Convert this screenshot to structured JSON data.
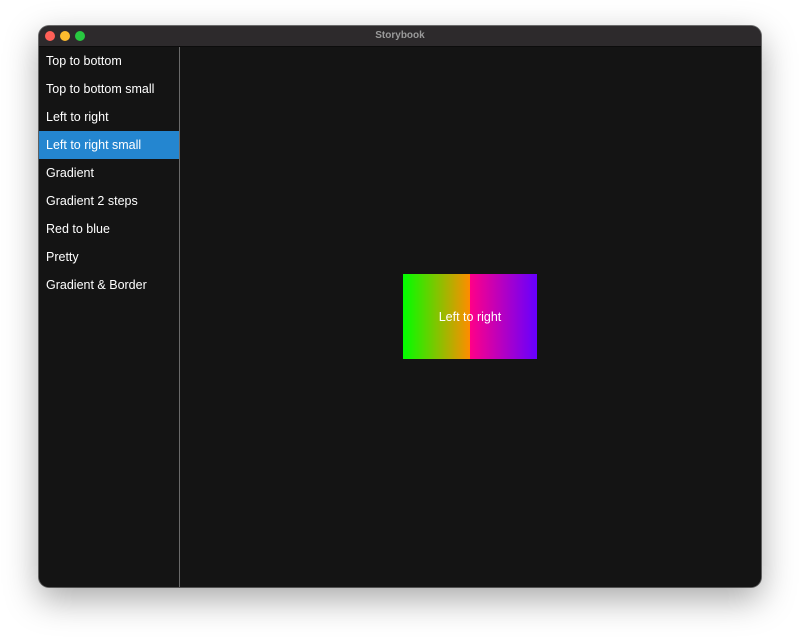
{
  "window": {
    "title": "Storybook"
  },
  "sidebar": {
    "selected_index": 3,
    "selected_color": "#2486d0",
    "items": [
      {
        "label": "Top to bottom"
      },
      {
        "label": "Top to bottom small"
      },
      {
        "label": "Left to right"
      },
      {
        "label": "Left to right small"
      },
      {
        "label": "Gradient"
      },
      {
        "label": "Gradient 2 steps"
      },
      {
        "label": "Red to blue"
      },
      {
        "label": "Pretty"
      },
      {
        "label": "Gradient & Border"
      }
    ]
  },
  "preview": {
    "label": "Left to right",
    "gradient_stops": [
      "#00ff00",
      "#ff8c00",
      "#ff0088",
      "#6600ff"
    ]
  }
}
